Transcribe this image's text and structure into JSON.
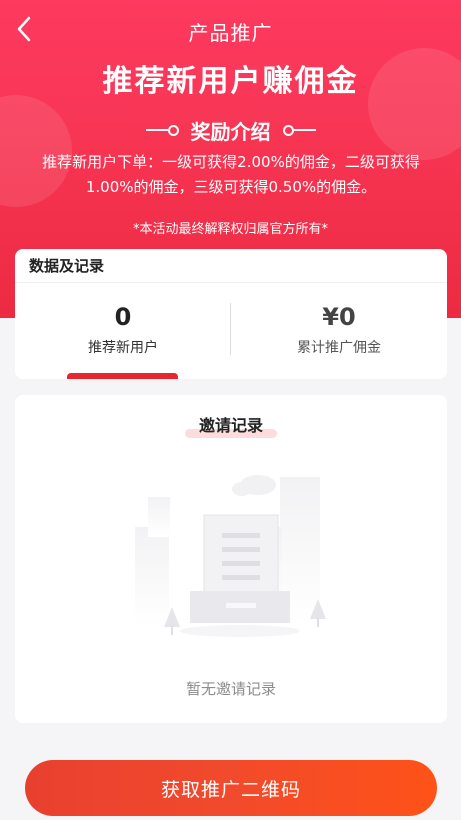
{
  "header": {
    "title": "产品推广",
    "headline": "推荐新用户赚佣金"
  },
  "reward_intro": {
    "title": "奖励介绍",
    "description": "推荐新用户下单：一级可获得2.00%的佣金，二级可获得1.00%的佣金，三级可获得0.50%的佣金。",
    "disclaimer": "*本活动最终解释权归属官方所有*"
  },
  "stats": {
    "title": "数据及记录",
    "new_users": {
      "value": "0",
      "label": "推荐新用户"
    },
    "commission": {
      "value": "¥0",
      "label": "累计推广佣金"
    }
  },
  "invite_records": {
    "title": "邀请记录",
    "empty_text": "暂无邀请记录"
  },
  "cta": {
    "label": "获取推广二维码"
  },
  "colors": {
    "hero_start": "#fd3a5f",
    "hero_end": "#ec2a41",
    "accent_red": "#e8262f",
    "button_start": "#e8402f",
    "button_end": "#fe5218"
  }
}
